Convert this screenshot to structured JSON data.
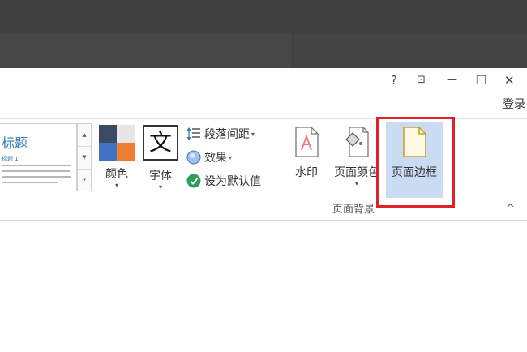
{
  "window_controls": {
    "help": "?",
    "restore_ribbon": "⊡",
    "minimize": "—",
    "restore": "❐",
    "close": "✕"
  },
  "account": {
    "login": "登录"
  },
  "style_gallery": {
    "title": "标题",
    "subtitle": "标题 1",
    "scroll_up": "▲",
    "scroll_down": "▼",
    "more": "▾"
  },
  "design_buttons": {
    "colors": {
      "label": "颜色"
    },
    "fonts": {
      "label": "字体",
      "glyph": "文"
    },
    "paragraph_spacing": "段落间距",
    "effects": "效果",
    "set_default": "设为默认值"
  },
  "page_background": {
    "group_label": "页面背景",
    "watermark": "水印",
    "page_color": "页面颜色",
    "page_borders": "页面边框"
  },
  "dropdown_glyph": "▾",
  "collapse_glyph": "^",
  "colors": {
    "palette": [
      "#3b4a64",
      "#e7e6e6",
      "#4472c4",
      "#ed7d31"
    ],
    "selected_bg": "#c9dcf3",
    "highlight_border": "#e0202a",
    "accent_blue": "#2e74b5"
  },
  "icons": {
    "help": "help-icon",
    "restore_ribbon": "ribbon-display-icon",
    "minimize": "minimize-icon",
    "restore": "restore-icon",
    "close": "close-icon",
    "paragraph_spacing": "paragraph-spacing-icon",
    "effects": "effects-icon",
    "set_default": "checkmark-icon",
    "watermark": "watermark-icon",
    "page_color": "paint-bucket-icon",
    "page_borders": "page-borders-icon"
  }
}
